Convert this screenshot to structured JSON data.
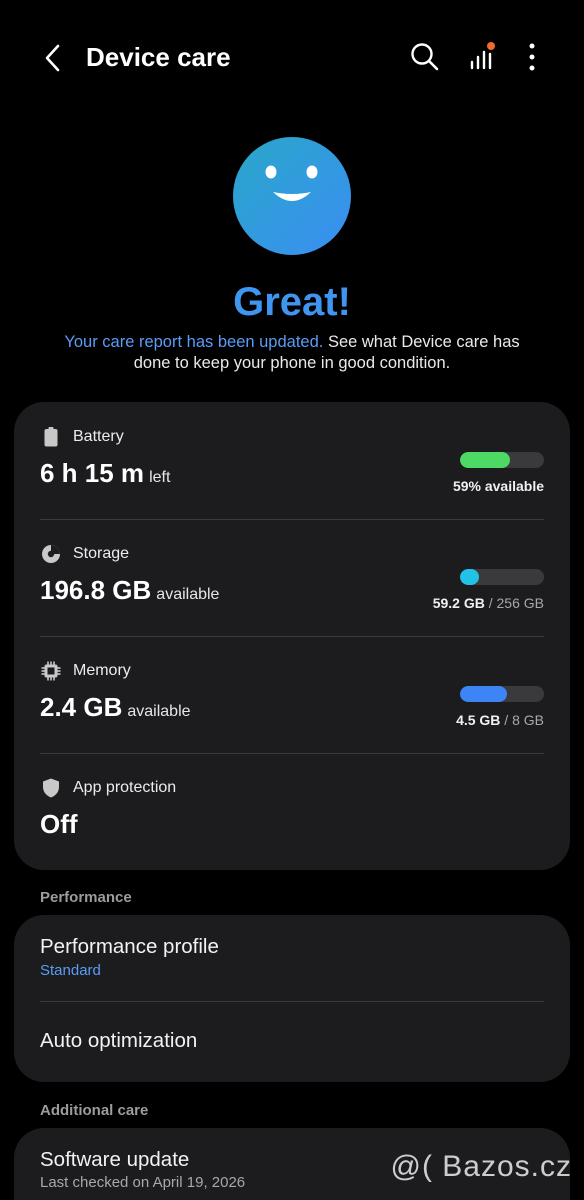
{
  "header": {
    "title": "Device care",
    "icons": [
      "back-arrow-icon",
      "search-icon",
      "stats-icon",
      "more-vert-icon"
    ]
  },
  "status": {
    "title": "Great!",
    "desc_link": "Your care report has been updated.",
    "desc_rest": " See what Device care has done to keep your phone in good condition."
  },
  "colors": {
    "accent": "#3f95f0",
    "link": "#5a9cf8",
    "battery": "#4cd964",
    "storage": "#22c2e6",
    "memory": "#3d84f7",
    "card": "#1c1c1e",
    "notification_dot": "#f26b2a"
  },
  "items": {
    "battery": {
      "label": "Battery",
      "value": "6 h 15 m",
      "unit": "left",
      "metric": "59% available",
      "fraction": 0.59
    },
    "storage": {
      "label": "Storage",
      "value": "196.8 GB",
      "unit": "available",
      "used": "59.2 GB",
      "total": " / 256 GB",
      "fraction": 0.23
    },
    "memory": {
      "label": "Memory",
      "value": "2.4 GB",
      "unit": "available",
      "used": "4.5 GB",
      "total": " / 8 GB",
      "fraction": 0.56
    },
    "app_protection": {
      "label": "App protection",
      "value": "Off"
    }
  },
  "performance": {
    "section_label": "Performance",
    "profile_title": "Performance profile",
    "profile_value": "Standard",
    "auto_title": "Auto optimization"
  },
  "additional": {
    "section_label": "Additional care",
    "software_title": "Software update",
    "software_sub": "Last checked on April 19, 2026"
  },
  "watermark": "@( Bazos.cz"
}
